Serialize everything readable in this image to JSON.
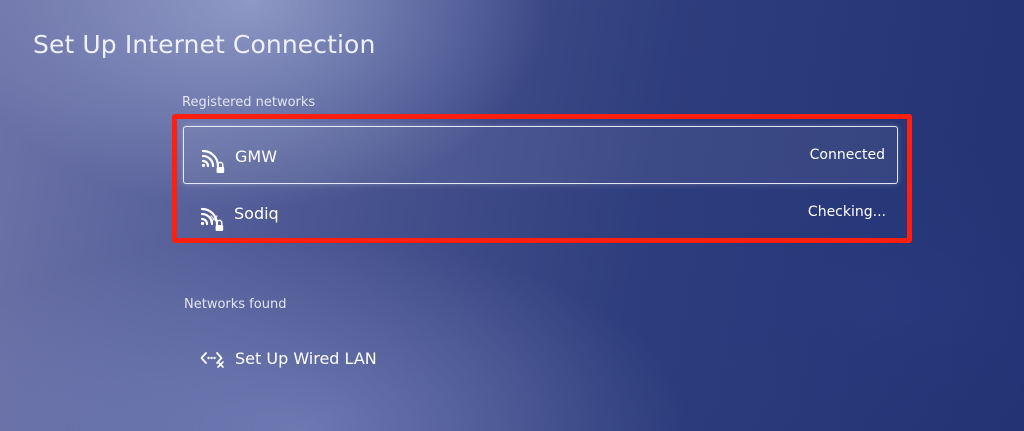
{
  "page": {
    "title": "Set Up Internet Connection"
  },
  "registered": {
    "heading": "Registered networks",
    "networks": [
      {
        "name": "GMW",
        "status": "Connected",
        "icon": "wifi-locked-icon",
        "selected": true
      },
      {
        "name": "Sodiq",
        "status": "Checking...",
        "icon": "wifi-locked-icon",
        "selected": false
      }
    ]
  },
  "found": {
    "heading": "Networks found",
    "wired": {
      "label": "Set Up Wired LAN",
      "icon": "wired-lan-disconnected-icon"
    }
  },
  "colors": {
    "highlight": "#ff1f0f",
    "background_start": "#6c73a8",
    "background_end": "#223272",
    "text": "#ffffff"
  }
}
